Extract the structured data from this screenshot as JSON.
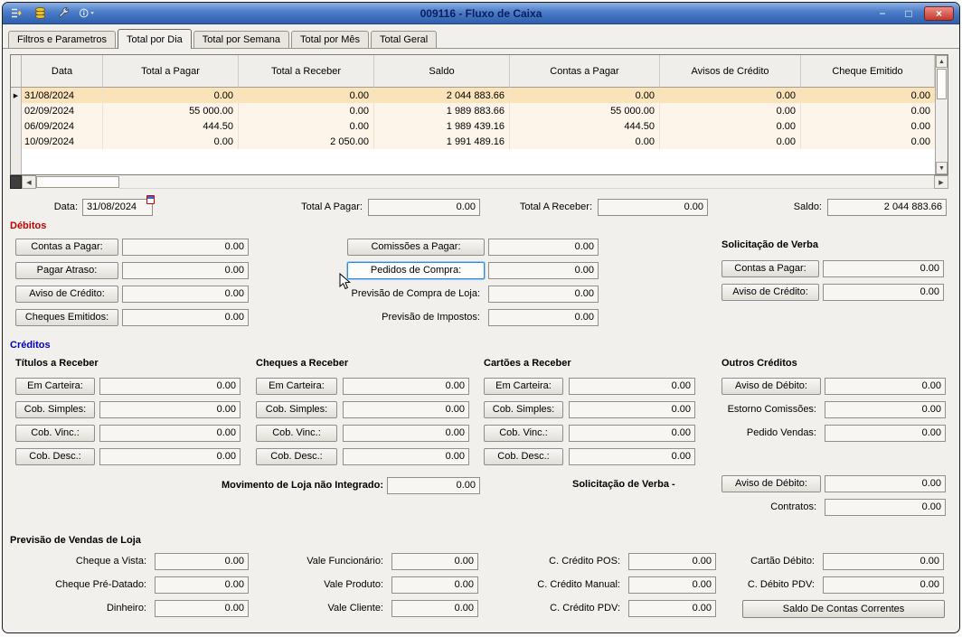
{
  "window": {
    "title": "009116 - Fluxo de Caixa",
    "controls": {
      "minimize": "−",
      "maximize": "□",
      "close": "×"
    }
  },
  "icons": {
    "up": "▲",
    "down": "▼",
    "left": "◀",
    "right": "▶",
    "row_marker": "▶"
  },
  "tabs": [
    {
      "label": "Filtros e Parametros"
    },
    {
      "label": "Total por Dia"
    },
    {
      "label": "Total por Semana"
    },
    {
      "label": "Total por Mês"
    },
    {
      "label": "Total Geral"
    }
  ],
  "active_tab": 1,
  "grid": {
    "columns": [
      "Data",
      "Total a Pagar",
      "Total a Receber",
      "Saldo",
      "Contas a Pagar",
      "Avisos de Crédito",
      "Cheque Emitido"
    ],
    "rows": [
      {
        "selected": true,
        "cells": [
          "31/08/2024",
          "0.00",
          "0.00",
          "2 044 883.66",
          "0.00",
          "0.00",
          "0.00"
        ]
      },
      {
        "selected": false,
        "cells": [
          "02/09/2024",
          "55 000.00",
          "0.00",
          "1 989 883.66",
          "55 000.00",
          "0.00",
          "0.00"
        ]
      },
      {
        "selected": false,
        "cells": [
          "06/09/2024",
          "444.50",
          "0.00",
          "1 989 439.16",
          "444.50",
          "0.00",
          "0.00"
        ]
      },
      {
        "selected": false,
        "cells": [
          "10/09/2024",
          "0.00",
          "2 050.00",
          "1 991 489.16",
          "0.00",
          "0.00",
          "0.00"
        ]
      }
    ]
  },
  "summary": {
    "fields": [
      {
        "label": "Data:",
        "value": "31/08/2024"
      },
      {
        "label": "Total A Pagar:",
        "value": "0.00"
      },
      {
        "label": "Total A Receber:",
        "value": "0.00"
      },
      {
        "label": "Saldo:",
        "value": "2 044 883.66"
      }
    ]
  },
  "debitos": {
    "title": "Débitos",
    "left": [
      {
        "label": "Contas a Pagar:",
        "value": "0.00",
        "button": true
      },
      {
        "label": "Pagar Atraso:",
        "value": "0.00",
        "button": true
      },
      {
        "label": "Aviso de Crédito:",
        "value": "0.00",
        "button": true
      },
      {
        "label": "Cheques Emitidos:",
        "value": "0.00",
        "button": true
      }
    ],
    "middle": [
      {
        "label": "Comissões a Pagar:",
        "value": "0.00",
        "button": true
      },
      {
        "label": "Pedidos de Compra:",
        "value": "0.00",
        "button": true,
        "focused": true
      },
      {
        "label": "Previsão de Compra de Loja:",
        "value": "0.00",
        "button": false
      },
      {
        "label": "Previsão de Impostos:",
        "value": "0.00",
        "button": false
      }
    ],
    "verba": {
      "title": "Solicitação de Verba",
      "items": [
        {
          "label": "Contas a Pagar:",
          "value": "0.00",
          "button": true
        },
        {
          "label": "Aviso de Crédito:",
          "value": "0.00",
          "button": true
        }
      ]
    }
  },
  "creditos": {
    "title": "Créditos",
    "groups": [
      {
        "title": "Títulos a Receber",
        "items": [
          {
            "label": "Em Carteira:",
            "value": "0.00",
            "button": true
          },
          {
            "label": "Cob. Simples:",
            "value": "0.00",
            "button": true
          },
          {
            "label": "Cob. Vinc.:",
            "value": "0.00",
            "button": true
          },
          {
            "label": "Cob. Desc.:",
            "value": "0.00",
            "button": true
          }
        ]
      },
      {
        "title": "Cheques a Receber",
        "items": [
          {
            "label": "Em Carteira:",
            "value": "0.00",
            "button": true
          },
          {
            "label": "Cob. Simples:",
            "value": "0.00",
            "button": true
          },
          {
            "label": "Cob. Vinc.:",
            "value": "0.00",
            "button": true
          },
          {
            "label": "Cob. Desc.:",
            "value": "0.00",
            "button": true
          }
        ]
      },
      {
        "title": "Cartões a Receber",
        "items": [
          {
            "label": "Em Carteira:",
            "value": "0.00",
            "button": true
          },
          {
            "label": "Cob. Simples:",
            "value": "0.00",
            "button": true
          },
          {
            "label": "Cob. Vinc.:",
            "value": "0.00",
            "button": true
          },
          {
            "label": "Cob. Desc.:",
            "value": "0.00",
            "button": true
          }
        ]
      }
    ],
    "outros": {
      "title": "Outros Créditos",
      "items": [
        {
          "label": "Aviso de Débito:",
          "value": "0.00",
          "button": true
        },
        {
          "label": "Estorno Comissões:",
          "value": "0.00",
          "button": false
        },
        {
          "label": "Pedido Vendas:",
          "value": "0.00",
          "button": false
        }
      ]
    },
    "movimento": {
      "label": "Movimento de Loja não Integrado:",
      "value": "0.00"
    },
    "verba": {
      "title": "Solicitação de Verba -",
      "items": [
        {
          "label": "Aviso de Débito:",
          "value": "0.00",
          "button": true
        },
        {
          "label": "Contratos:",
          "value": "0.00",
          "button": false
        }
      ]
    }
  },
  "previsao": {
    "title": "Previsão de Vendas de Loja",
    "col1": [
      {
        "label": "Cheque a Vista:",
        "value": "0.00",
        "button": false
      },
      {
        "label": "Cheque Pré-Datado:",
        "value": "0.00",
        "button": false
      },
      {
        "label": "Dinheiro:",
        "value": "0.00",
        "button": false
      }
    ],
    "col2": [
      {
        "label": "Vale Funcionário:",
        "value": "0.00",
        "button": false
      },
      {
        "label": "Vale Produto:",
        "value": "0.00",
        "button": false
      },
      {
        "label": "Vale Cliente:",
        "value": "0.00",
        "button": false
      }
    ],
    "col3": [
      {
        "label": "C. Crédito POS:",
        "value": "0.00",
        "button": false
      },
      {
        "label": "C. Crédito Manual:",
        "value": "0.00",
        "button": false
      },
      {
        "label": "C. Crédito PDV:",
        "value": "0.00",
        "button": false
      }
    ],
    "col4": [
      {
        "label": "Cartão Débito:",
        "value": "0.00",
        "button": false
      },
      {
        "label": "C. Débito PDV:",
        "value": "0.00",
        "button": false
      }
    ],
    "button": "Saldo De Contas Correntes"
  }
}
